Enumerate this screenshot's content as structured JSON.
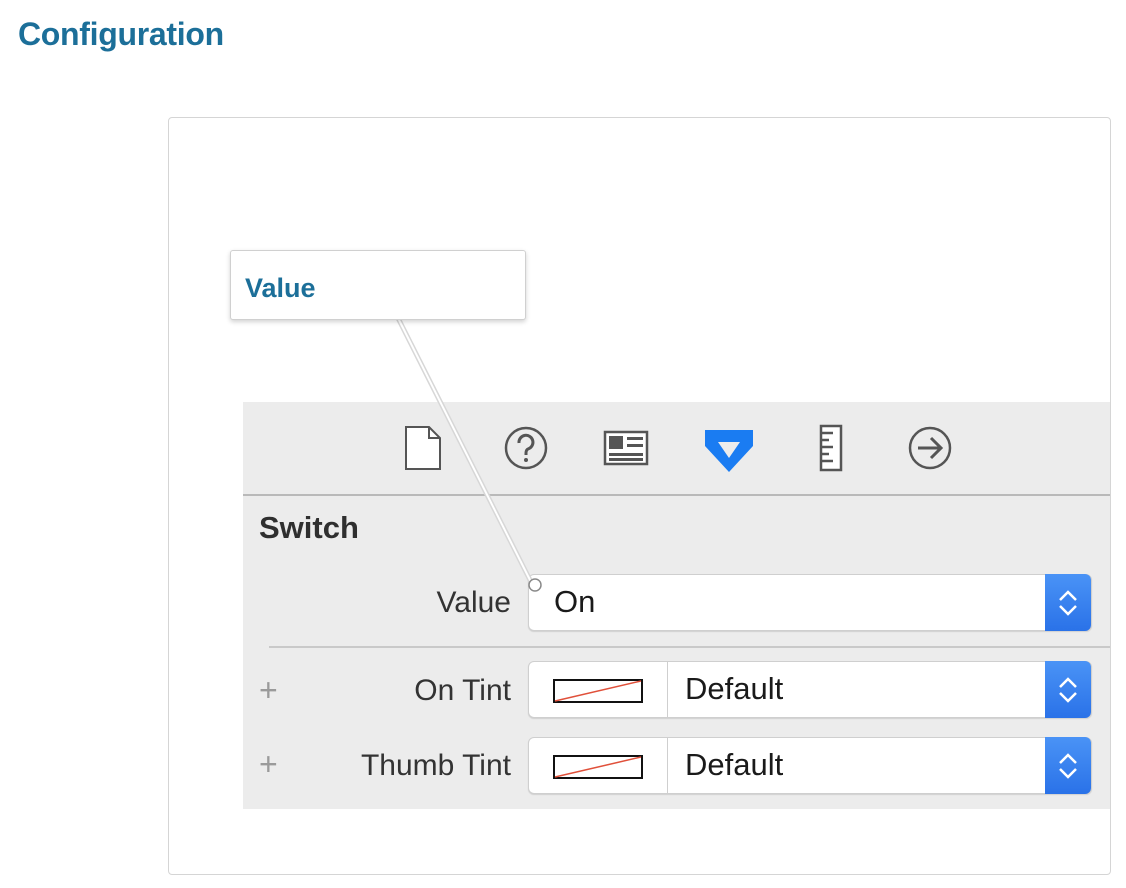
{
  "page": {
    "heading": "Configuration"
  },
  "callout": {
    "label": "Value"
  },
  "toolbar": {
    "icons": [
      "file-icon",
      "help-icon",
      "identity-icon",
      "attributes-icon",
      "size-icon",
      "connections-icon"
    ],
    "selected": "attributes-icon",
    "accent": "#1a7cf2"
  },
  "inspector": {
    "section_title": "Switch",
    "value_row": {
      "label": "Value",
      "selected": "On"
    },
    "on_tint_row": {
      "label": "On Tint",
      "selected": "Default",
      "plus": "+"
    },
    "thumb_tint_row": {
      "label": "Thumb Tint",
      "selected": "Default",
      "plus": "+"
    }
  }
}
